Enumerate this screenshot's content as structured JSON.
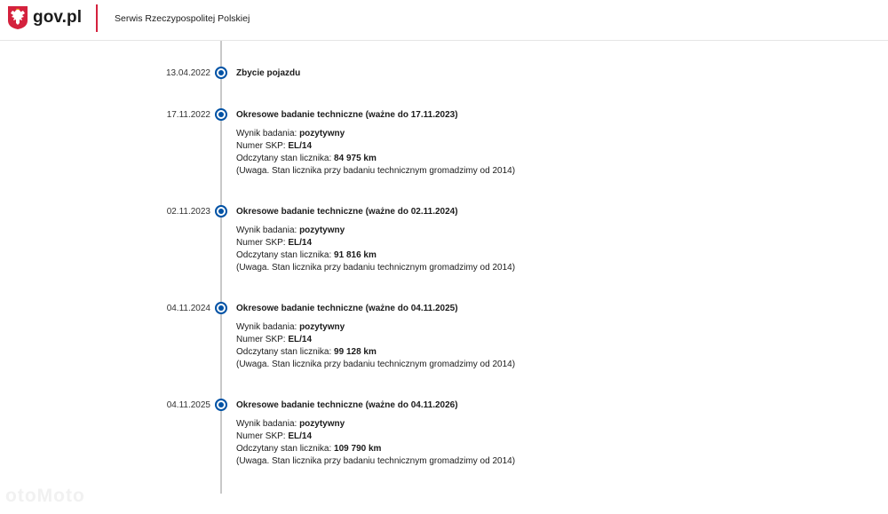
{
  "header": {
    "logo_text": "gov.pl",
    "service_name": "Serwis Rzeczypospolitej Polskiej"
  },
  "events": [
    {
      "date": "13.04.2022",
      "title": "Zbycie pojazdu"
    },
    {
      "date": "17.11.2022",
      "title": "Okresowe badanie techniczne (ważne do 17.11.2023)",
      "result_label": "Wynik badania:",
      "result_value": "pozytywny",
      "skp_label": "Numer SKP:",
      "skp_value": "EL/14",
      "odometer_label": "Odczytany stan licznika:",
      "odometer_value": "84 975 km",
      "note": "(Uwaga. Stan licznika przy badaniu technicznym gromadzimy od 2014)"
    },
    {
      "date": "02.11.2023",
      "title": "Okresowe badanie techniczne (ważne do 02.11.2024)",
      "result_label": "Wynik badania:",
      "result_value": "pozytywny",
      "skp_label": "Numer SKP:",
      "skp_value": "EL/14",
      "odometer_label": "Odczytany stan licznika:",
      "odometer_value": "91 816 km",
      "note": "(Uwaga. Stan licznika przy badaniu technicznym gromadzimy od 2014)"
    },
    {
      "date": "04.11.2024",
      "title": "Okresowe badanie techniczne (ważne do 04.11.2025)",
      "result_label": "Wynik badania:",
      "result_value": "pozytywny",
      "skp_label": "Numer SKP:",
      "skp_value": "EL/14",
      "odometer_label": "Odczytany stan licznika:",
      "odometer_value": "99 128 km",
      "note": "(Uwaga. Stan licznika przy badaniu technicznym gromadzimy od 2014)"
    },
    {
      "date": "04.11.2025",
      "title": "Okresowe badanie techniczne (ważne do 04.11.2026)",
      "result_label": "Wynik badania:",
      "result_value": "pozytywny",
      "skp_label": "Numer SKP:",
      "skp_value": "EL/14",
      "odometer_label": "Odczytany stan licznika:",
      "odometer_value": "109 790 km",
      "note": "(Uwaga. Stan licznika przy badaniu technicznym gromadzimy od 2014)"
    }
  ],
  "watermark": "otoMoto",
  "colors": {
    "accent_red": "#d4213d",
    "timeline_blue": "#0052a5"
  }
}
